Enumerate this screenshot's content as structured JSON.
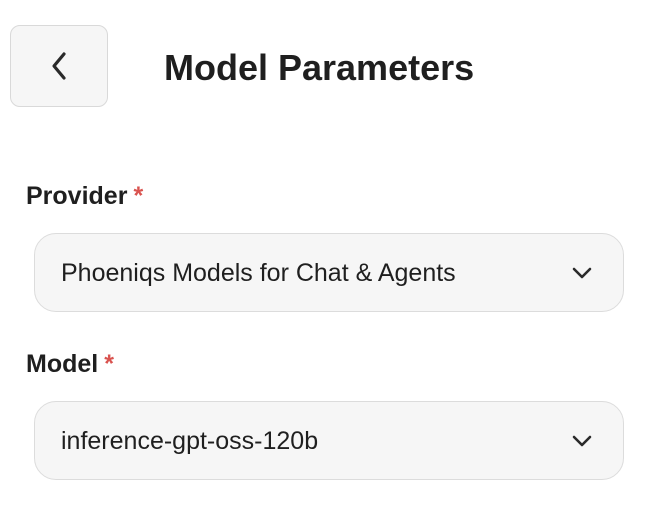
{
  "header": {
    "title": "Model Parameters",
    "back_icon": "chevron-left-icon"
  },
  "form": {
    "provider": {
      "label": "Provider",
      "required_mark": "*",
      "value": "Phoeniqs Models for Chat & Agents",
      "icon": "chevron-down-icon"
    },
    "model": {
      "label": "Model",
      "required_mark": "*",
      "value": "inference-gpt-oss-120b",
      "icon": "chevron-down-icon"
    }
  },
  "colors": {
    "required": "#d9534f",
    "field_background": "#f6f6f6",
    "field_border": "#dcdcdc",
    "text": "#1f1f1f"
  }
}
